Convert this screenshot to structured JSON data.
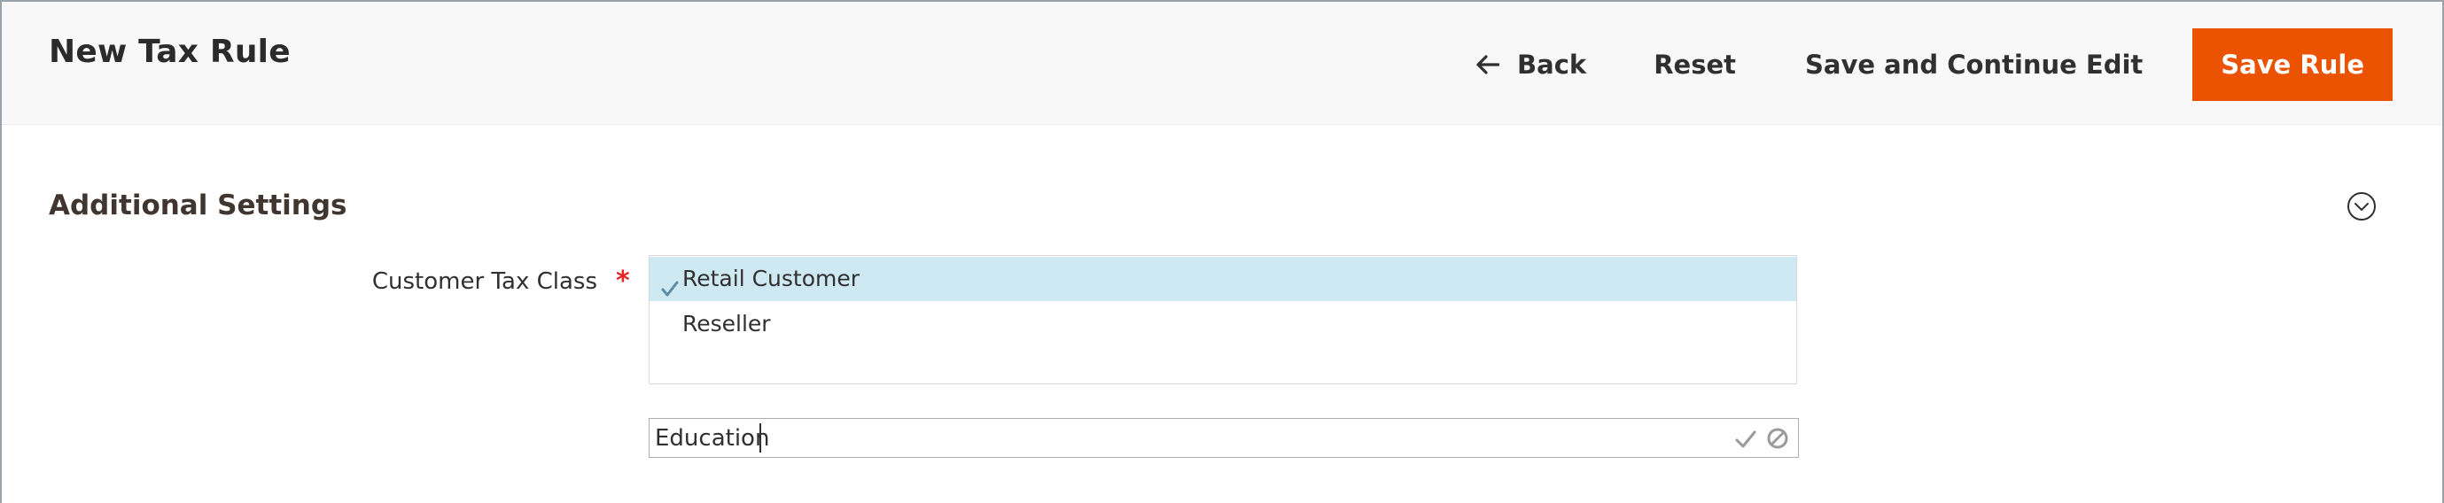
{
  "header": {
    "title": "New Tax Rule",
    "actions": {
      "back_label": "Back",
      "reset_label": "Reset",
      "save_continue_label": "Save and Continue Edit",
      "save_rule_label": "Save Rule"
    }
  },
  "section": {
    "title": "Additional Settings",
    "collapse_icon": "chevron-down-circle-icon"
  },
  "customer_tax_class": {
    "label": "Customer Tax Class",
    "required_marker": "*",
    "options": [
      {
        "label": "Retail Customer",
        "selected": true
      },
      {
        "label": "Reseller",
        "selected": false
      }
    ],
    "new_class_input": {
      "value": "Education"
    }
  },
  "colors": {
    "primary_button": "#eb5202",
    "selected_option_bg": "#cfe9f3",
    "required": "#e22626",
    "header_bg": "#f8f8f8"
  },
  "icons": {
    "back": "arrow-left-icon",
    "option_check": "check-icon",
    "input_confirm": "check-icon",
    "input_cancel": "cancel-icon"
  }
}
